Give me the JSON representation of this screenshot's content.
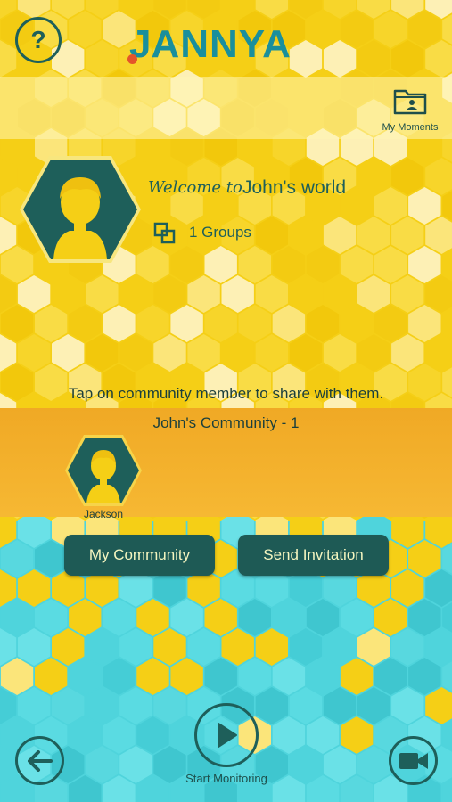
{
  "app": {
    "logo_text_j": "J",
    "logo_text_rest": "ANNYA"
  },
  "header": {
    "help_label": "?",
    "my_moments_label": "My Moments"
  },
  "profile": {
    "welcome_prefix": "Welcome to",
    "welcome_name": "John's world",
    "groups_label": "1 Groups"
  },
  "community": {
    "instruction": "Tap on community member to share with them.",
    "title": "John's Community - 1",
    "members": [
      {
        "name": "Jackson"
      }
    ]
  },
  "actions": {
    "my_community_label": "My Community",
    "send_invitation_label": "Send Invitation"
  },
  "footer": {
    "start_monitoring_label": "Start Monitoring"
  },
  "colors": {
    "yellow_bg": "#f5cf16",
    "orange_bar": "#f2ae2a",
    "teal_bg": "#4fd4dc",
    "dark_teal": "#1e5f5a",
    "logo_teal": "#1a8f9c",
    "logo_dot": "#e4552a"
  }
}
